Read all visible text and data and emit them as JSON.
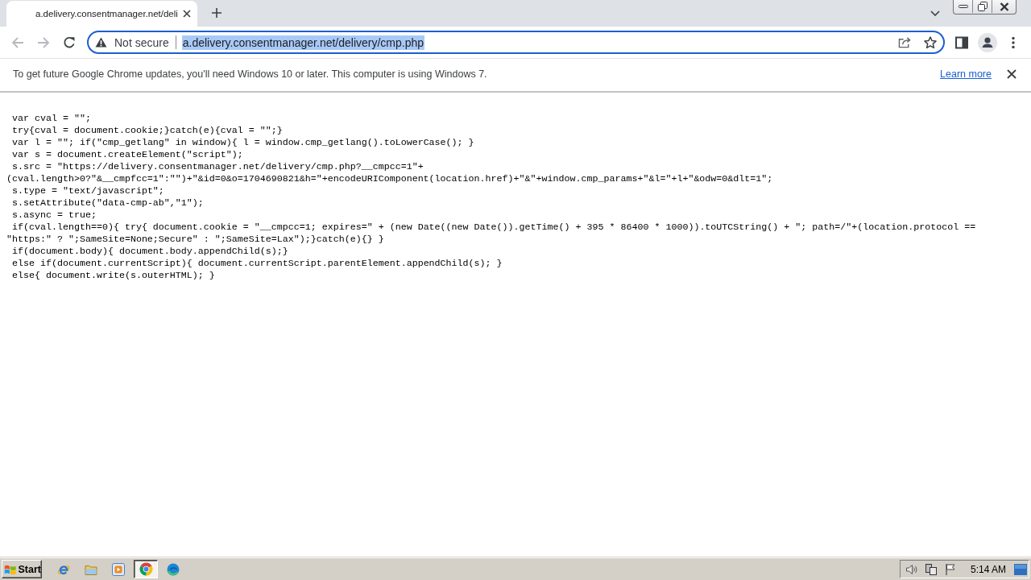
{
  "browser": {
    "tabs": [
      {
        "title": "a.delivery.consentmanager.net/deli",
        "selected": true
      }
    ],
    "navigation": {
      "back": {
        "disabled": true
      },
      "forward": {
        "disabled": true
      }
    },
    "address_bar": {
      "security_label": "Not secure",
      "url": {
        "text": "a.delivery.consentmanager.net/delivery/cmp.php",
        "selected": true
      }
    },
    "infobar": {
      "message": "To get future Google Chrome updates, you'll need Windows 10 or later. This computer is using Windows 7.",
      "link": "Learn more"
    }
  },
  "page": {
    "code_lines": [
      {
        "kind": "statement",
        "text": "var cval = \"\";"
      },
      {
        "kind": "statement",
        "text": "try{cval = document.cookie;}catch(e){cval = \"\";}"
      },
      {
        "kind": "statement",
        "text": "var l = \"\"; if(\"cmp_getlang\" in window){ l = window.cmp_getlang().toLowerCase(); }"
      },
      {
        "kind": "statement",
        "text": "var s = document.createElement(\"script\");"
      },
      {
        "kind": "statement",
        "text": "s.src = \"https://delivery.consentmanager.net/delivery/cmp.php?__cmpcc=1\"+"
      },
      {
        "kind": "wrap",
        "text": "(cval.length>0?\"&__cmpfcc=1\":\"\")+\"&id=0&o=1704690821&h=\"+encodeURIComponent(location.href)+\"&\"+window.cmp_params+\"&l=\"+l+\"&odw=0&dlt=1\";"
      },
      {
        "kind": "statement",
        "text": "s.type = \"text/javascript\";"
      },
      {
        "kind": "statement",
        "text": "s.setAttribute(\"data-cmp-ab\",\"1\");"
      },
      {
        "kind": "statement",
        "text": "s.async = true;"
      },
      {
        "kind": "statement",
        "text": "if(cval.length==0){ try{ document.cookie = \"__cmpcc=1; expires=\" + (new Date((new Date()).getTime() + 395 * 86400 * 1000)).toUTCString() + \"; path=/\"+(location.protocol =="
      },
      {
        "kind": "wrap",
        "text": "\"https:\" ? \";SameSite=None;Secure\" : \";SameSite=Lax\");}catch(e){} }"
      },
      {
        "kind": "statement",
        "text": "if(document.body){ document.body.appendChild(s);}"
      },
      {
        "kind": "statement",
        "text": "else if(document.currentScript){ document.currentScript.parentElement.appendChild(s); }"
      },
      {
        "kind": "statement",
        "text": "else{ document.write(s.outerHTML); }"
      }
    ]
  },
  "taskbar": {
    "start_label": "Start",
    "apps": [
      {
        "selected": false
      },
      {
        "selected": false
      },
      {
        "selected": false
      },
      {
        "selected": true
      },
      {
        "selected": false
      }
    ],
    "clock": "5:14 AM"
  }
}
